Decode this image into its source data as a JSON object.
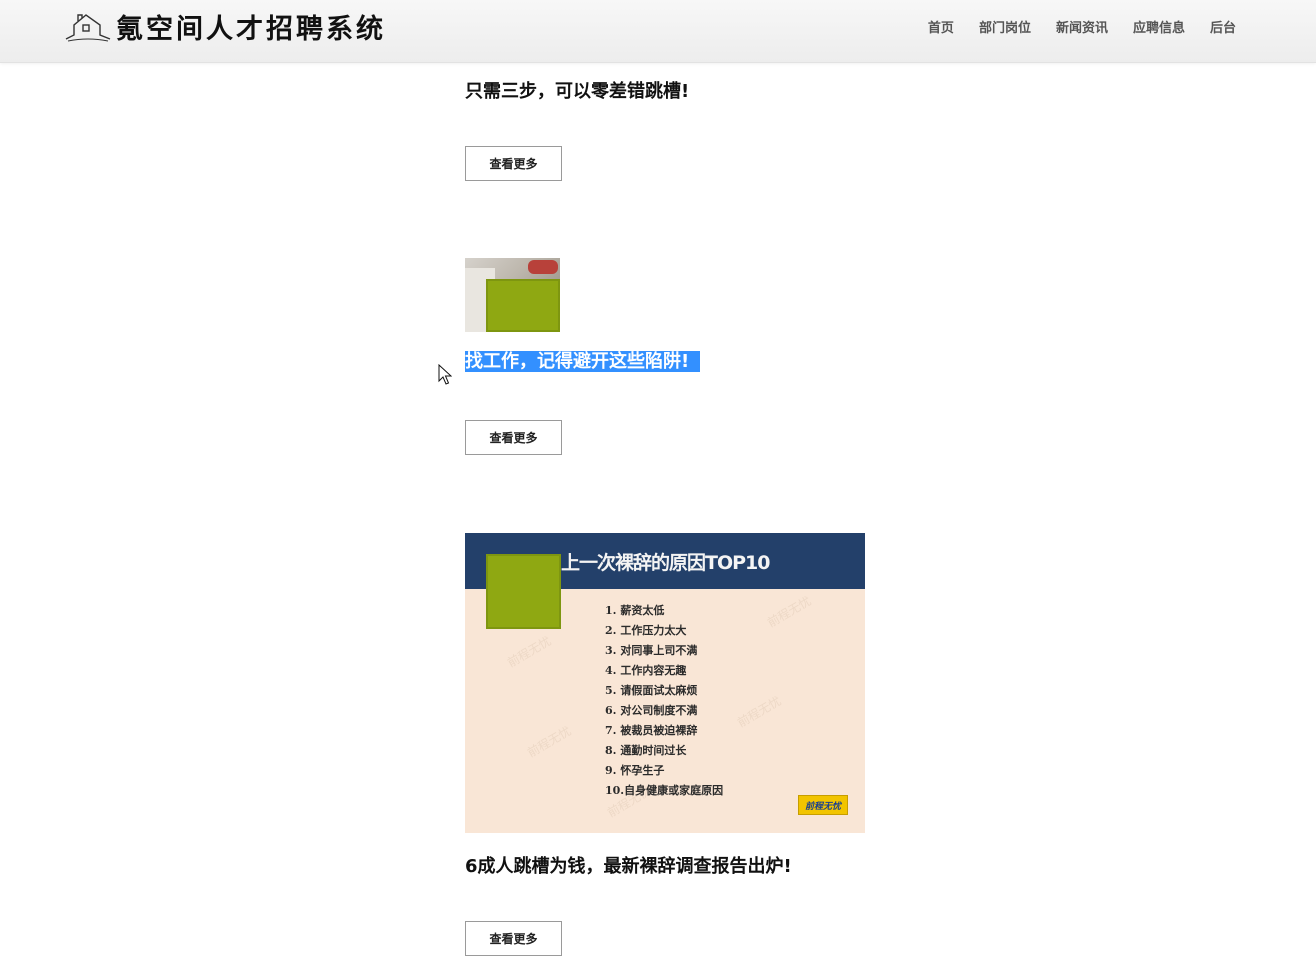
{
  "header": {
    "logo_text": "氪空间人才招聘系统",
    "nav": [
      "首页",
      "部门岗位",
      "新闻资讯",
      "应聘信息",
      "后台"
    ]
  },
  "articles": [
    {
      "title": "只需三步，可以零差错跳槽!",
      "button": "查看更多"
    },
    {
      "title": "找工作，记得避开这些陷阱!",
      "button": "查看更多"
    },
    {
      "title": "6成人跳槽为钱，最新裸辞调查报告出炉!",
      "button": "查看更多"
    }
  ],
  "poster": {
    "title": "上一次裸辞的原因TOP10",
    "items": [
      "1. 薪资太低",
      "2. 工作压力太大",
      "3. 对同事上司不满",
      "4. 工作内容无趣",
      "5. 请假面试太麻烦",
      "6. 对公司制度不满",
      "7. 被裁员被迫裸辞",
      "8. 通勤时间过长",
      "9. 怀孕生子",
      "10.自身健康或家庭原因"
    ],
    "badge": "前程无忧"
  },
  "colors": {
    "selection": "#3390ff",
    "placeholder_green": "#8fa812",
    "poster_header": "#23406a"
  }
}
